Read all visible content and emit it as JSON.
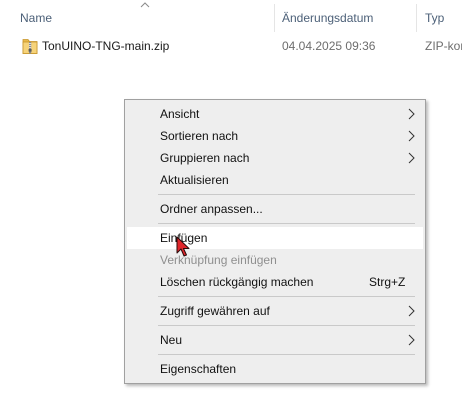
{
  "columns": {
    "name": "Name",
    "modified": "Änderungsdatum",
    "type": "Typ",
    "sort_icon": "sort-ascending-icon"
  },
  "files": [
    {
      "icon": "zip-folder-icon",
      "name": "TonUINO-TNG-main.zip",
      "modified": "04.04.2025 09:36",
      "type": "ZIP-kor"
    }
  ],
  "context_menu": {
    "view": "Ansicht",
    "sort_by": "Sortieren nach",
    "group_by": "Gruppieren nach",
    "refresh": "Aktualisieren",
    "customize_folder": "Ordner anpassen...",
    "paste": "Einfügen",
    "paste_shortcut": "Verknüpfung einfügen",
    "undo_delete": "Löschen rückgängig machen",
    "undo_delete_shortcut": "Strg+Z",
    "give_access": "Zugriff gewähren auf",
    "new": "Neu",
    "properties": "Eigenschaften",
    "hovered_item": "Einfügen",
    "disabled_item": "Verknüpfung einfügen"
  },
  "colors": {
    "header_text": "#4c6078",
    "menu_background": "#eeeeee",
    "menu_hover": "#ffffff",
    "disabled_text": "#8f8f8f",
    "cursor_fill": "#e0252b"
  },
  "cursor_icon": "arrow-pointer-icon"
}
